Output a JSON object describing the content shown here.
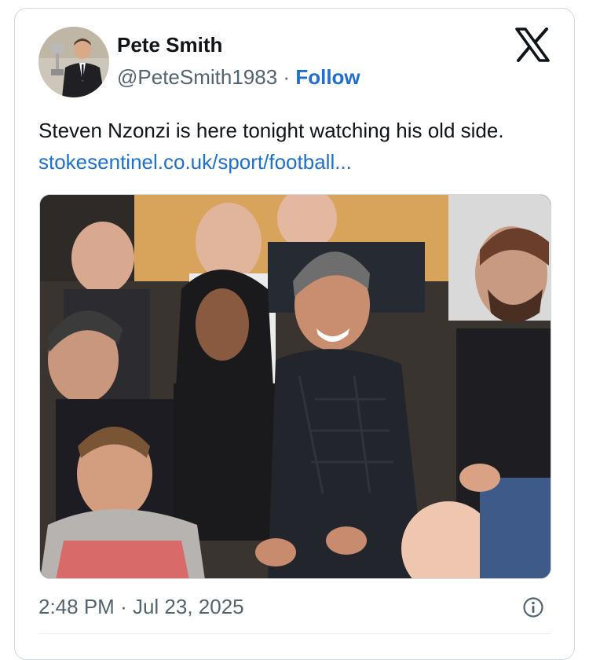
{
  "author": {
    "name": "Pete Smith",
    "handle": "@PeteSmith1983",
    "separator": "·",
    "follow_label": "Follow"
  },
  "platform_icon": "x-logo-icon",
  "tweet": {
    "text": "Steven Nzonzi is here tonight watching his old side. ",
    "link_text": "stokesentinel.co.uk/sport/football..."
  },
  "media": {
    "kind": "photo",
    "subject_icon": "crowd-photo"
  },
  "meta": {
    "time": "2:48 PM",
    "separator": "·",
    "date": "Jul 23, 2025"
  },
  "icons": {
    "info": "info-icon"
  },
  "colors": {
    "link": "#1d6fd1",
    "secondary_text": "#536471",
    "border": "#cfd9de"
  }
}
